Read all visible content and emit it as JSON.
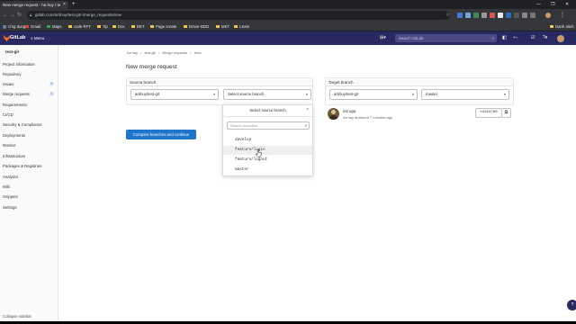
{
  "browser": {
    "tab_title": "New merge request · ha huy / te",
    "tab_close": "×",
    "new_tab": "+",
    "url": "gitlab.com/arkhuy/test-git/-/merge_requests/new",
    "window_controls": [
      "—",
      "❐",
      "✕"
    ],
    "bookmarks": [
      "Ứng dụng",
      "Gmail",
      "Maps",
      "code RFT",
      "Tip",
      "Doc",
      "DET",
      "Page create",
      "Driver-DDD",
      "MKT",
      "LSam"
    ],
    "other_bookmarks": "Danh sách"
  },
  "gitlab": {
    "brand": "GitLab",
    "menu": "≡ Menu",
    "search_placeholder": "Search GitLab",
    "colors": {
      "header": "#292961",
      "primary": "#1f75cb"
    }
  },
  "sidebar": {
    "project": "test-git",
    "items": [
      {
        "label": "Project information"
      },
      {
        "label": "Repository"
      },
      {
        "label": "Issues",
        "badge": "0"
      },
      {
        "label": "Merge requests",
        "badge": "0"
      },
      {
        "label": "Requirements"
      },
      {
        "label": "CI/CD"
      },
      {
        "label": "Security & Compliance"
      },
      {
        "label": "Deployments"
      },
      {
        "label": "Monitor"
      },
      {
        "label": "Infrastructure"
      },
      {
        "label": "Packages & Registries"
      },
      {
        "label": "Analytics"
      },
      {
        "label": "Wiki"
      },
      {
        "label": "Snippets"
      },
      {
        "label": "Settings"
      }
    ],
    "collapse": "Collapse sidebar"
  },
  "breadcrumb": [
    "ha huy",
    "›",
    "test-git",
    "›",
    "Merge requests",
    "›",
    "New"
  ],
  "page_title": "New merge request",
  "source": {
    "header": "Source branch",
    "project": "arkhuy/test-git",
    "branch_placeholder": "Select source branch"
  },
  "target": {
    "header": "Target branch",
    "project": "arkhuy/test-git",
    "branch": "master"
  },
  "compare_button": "Compare branches and continue",
  "branch_dropdown": {
    "title": "Select source branch",
    "search_placeholder": "Search branches",
    "branches": [
      "develop",
      "feature/login",
      "feature/logout",
      "master"
    ],
    "hovered": "feature/login"
  },
  "commit": {
    "title": "init app",
    "author": "ha huy",
    "meta": "authored 7 minutes ago",
    "sha": "c3324788"
  },
  "help": "?"
}
